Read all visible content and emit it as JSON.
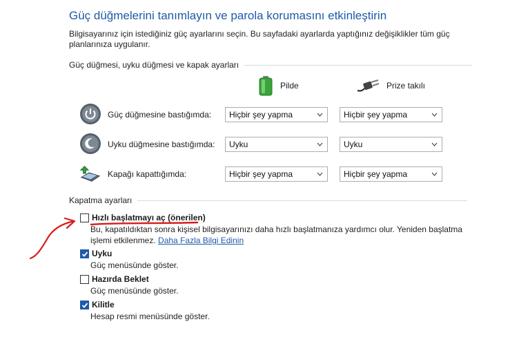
{
  "header": {
    "title": "Güç düğmelerini tanımlayın ve parola korumasını etkinleştirin",
    "description": "Bilgisayarınız için istediğiniz güç ayarlarını seçin. Bu sayfadaki ayarlarda yaptığınız değişiklikler tüm güç planlarınıza uygulanır."
  },
  "columns": {
    "battery": "Pilde",
    "plugged": "Prize takılı"
  },
  "buttons_group": {
    "title": "Güç düğmesi, uyku düğmesi ve kapak ayarları",
    "rows": [
      {
        "icon": "power-button-icon",
        "label": "Güç düğmesine bastığımda:",
        "battery": "Hiçbir şey yapma",
        "plugged": "Hiçbir şey yapma"
      },
      {
        "icon": "sleep-button-icon",
        "label": "Uyku düğmesine bastığımda:",
        "battery": "Uyku",
        "plugged": "Uyku"
      },
      {
        "icon": "laptop-lid-icon",
        "label": "Kapağı kapattığımda:",
        "battery": "Hiçbir şey yapma",
        "plugged": "Hiçbir şey yapma"
      }
    ]
  },
  "shutdown_group": {
    "title": "Kapatma ayarları",
    "options": [
      {
        "label": "Hızlı başlatmayı aç (önerilen)",
        "checked": false,
        "description": "Bu, kapatıldıktan sonra kişisel bilgisayarınızı daha hızlı başlatmanıza yardımcı olur. Yeniden başlatma işlemi etkilenmez.",
        "link": "Daha Fazla Bilgi Edinin"
      },
      {
        "label": "Uyku",
        "checked": true,
        "description": "Güç menüsünde göster."
      },
      {
        "label": "Hazırda Beklet",
        "checked": false,
        "description": "Güç menüsünde göster."
      },
      {
        "label": "Kilitle",
        "checked": true,
        "description": "Hesap resmi menüsünde göster."
      }
    ]
  },
  "colors": {
    "accent": "#1e5aa8",
    "annotation": "#d81b1b"
  }
}
